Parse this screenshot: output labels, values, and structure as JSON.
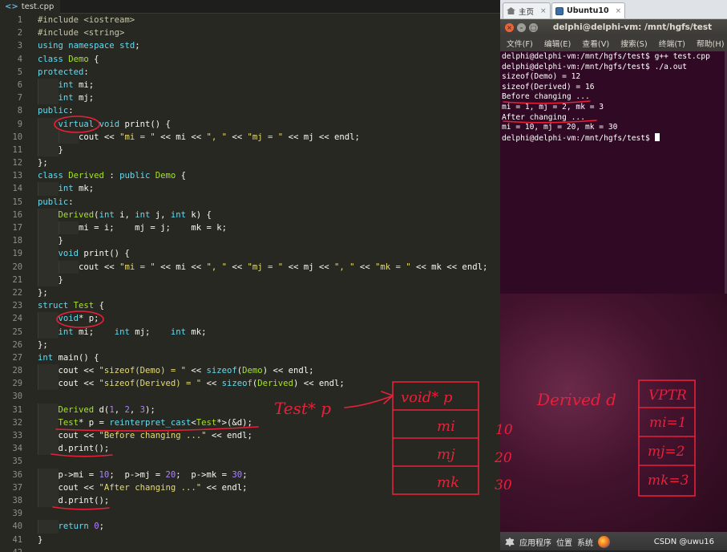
{
  "editor": {
    "tab_label": "test.cpp",
    "line_numbers": [
      "1",
      "2",
      "3",
      "4",
      "5",
      "6",
      "7",
      "8",
      "9",
      "10",
      "11",
      "12",
      "13",
      "14",
      "15",
      "16",
      "17",
      "18",
      "19",
      "20",
      "21",
      "22",
      "23",
      "24",
      "25",
      "26",
      "27",
      "28",
      "29",
      "30",
      "31",
      "32",
      "33",
      "34",
      "35",
      "36",
      "37",
      "38",
      "39",
      "40",
      "41",
      "42"
    ],
    "lines": [
      "#include <iostream>",
      "#include <string>",
      "using namespace std;",
      "class Demo {",
      "protected:",
      "    int mi;",
      "    int mj;",
      "public:",
      "    virtual void print() {",
      "        cout << \"mi = \" << mi << \", \" << \"mj = \" << mj << endl;",
      "    }",
      "};",
      "class Derived : public Demo {",
      "    int mk;",
      "public:",
      "    Derived(int i, int j, int k) {",
      "        mi = i;    mj = j;    mk = k;",
      "    }",
      "    void print() {",
      "        cout << \"mi = \" << mi << \", \" << \"mj = \" << mj << \", \" << \"mk = \" << mk << endl;",
      "    }",
      "};",
      "struct Test {",
      "    void* p;",
      "    int mi;    int mj;    int mk;",
      "};",
      "int main() {",
      "    cout << \"sizeof(Demo) = \" << sizeof(Demo) << endl;",
      "    cout << \"sizeof(Derived) = \" << sizeof(Derived) << endl;",
      "",
      "    Derived d(1, 2, 3);",
      "    Test* p = reinterpret_cast<Test*>(&d);",
      "    cout << \"Before changing ...\" << endl;",
      "    d.print();",
      "",
      "    p->mi = 10;  p->mj = 20;  p->mk = 30;",
      "    cout << \"After changing ...\" << endl;",
      "    d.print();",
      "",
      "    return 0;",
      "}",
      ""
    ]
  },
  "vm": {
    "tabs": [
      {
        "label": "主页",
        "close": "×"
      },
      {
        "label": "Ubuntu10",
        "close": "×"
      }
    ]
  },
  "terminal": {
    "title": "delphi@delphi-vm: /mnt/hgfs/test",
    "menu": [
      "文件(F)",
      "编辑(E)",
      "查看(V)",
      "搜索(S)",
      "终端(T)",
      "帮助(H)"
    ],
    "output": [
      "delphi@delphi-vm:/mnt/hgfs/test$ g++ test.cpp",
      "delphi@delphi-vm:/mnt/hgfs/test$ ./a.out",
      "sizeof(Demo) = 12",
      "sizeof(Derived) = 16",
      "Before changing ...",
      "mi = 1, mj = 2, mk = 3",
      "After changing ...",
      "mi = 10, mj = 20, mk = 30",
      "delphi@delphi-vm:/mnt/hgfs/test$ "
    ]
  },
  "panel": {
    "items": [
      "应用程序",
      "位置",
      "系统"
    ],
    "credit": "CSDN @uwu16"
  },
  "annotations": {
    "test_ptr_label": "Test* p",
    "struct_cells": [
      "void* p",
      "mi",
      "mj",
      "mk"
    ],
    "struct_values": [
      "10",
      "20",
      "30"
    ],
    "derived_label": "Derived d",
    "derived_cells": [
      "VPTR",
      "mi=1",
      "mj=2",
      "mk=3"
    ],
    "ink_color": "#e8203a"
  },
  "colors": {
    "editor_bg": "#272822",
    "terminal_bg": "#300a24",
    "keyword": "#66d9ef",
    "string": "#e6db74",
    "class_name": "#a6e22e",
    "number": "#ae81ff"
  }
}
